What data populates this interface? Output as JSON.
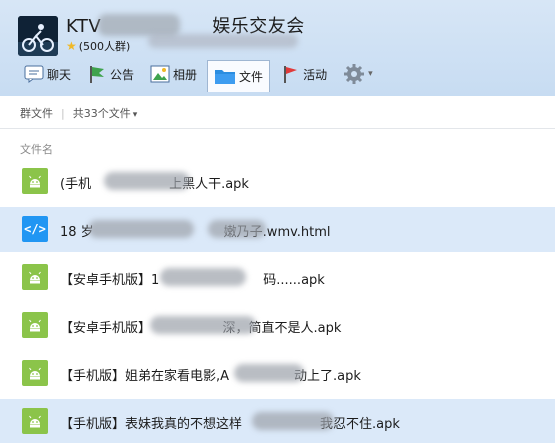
{
  "header": {
    "group_name": "KTV　　　　　　娱乐交友会",
    "member_count": "(500人群)",
    "tabs": [
      {
        "label": "聊天",
        "icon": "chat-icon"
      },
      {
        "label": "公告",
        "icon": "flag-icon"
      },
      {
        "label": "相册",
        "icon": "photo-icon"
      },
      {
        "label": "文件",
        "icon": "folder-icon"
      },
      {
        "label": "活动",
        "icon": "red-flag-icon"
      }
    ],
    "settings_icon": "gear-icon"
  },
  "breadcrumb": {
    "root": "群文件",
    "count": "共33个文件"
  },
  "list": {
    "column_header": "文件名",
    "files": [
      {
        "name": "(手机　　　　　　上黑人干.apk",
        "type": "apk"
      },
      {
        "name": "18 岁　　　　　　　　　　嫩乃子.wmv.html",
        "type": "html",
        "selected": true
      },
      {
        "name": "【安卓手机版】1　　　　　　　　码......apk",
        "type": "apk"
      },
      {
        "name": "【安卓手机版】　　　　　　深，简直不是人.apk",
        "type": "apk"
      },
      {
        "name": "【手机版】姐弟在家看电影,A　　　　　动上了.apk",
        "type": "apk"
      },
      {
        "name": "【手机版】表妹我真的不想这样　　　　　　我忍不住.apk",
        "type": "apk"
      }
    ]
  },
  "colors": {
    "header_bg": "#cfe1f4",
    "selected_row": "#dbe9f9",
    "apk_icon": "#8bc44a",
    "html_icon": "#2196f3"
  }
}
